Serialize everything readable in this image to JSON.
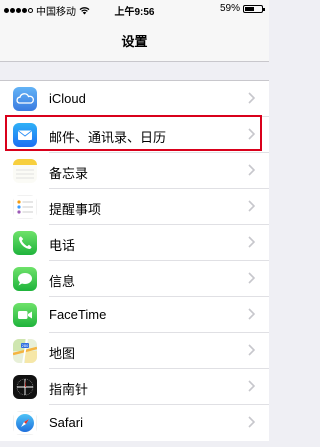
{
  "status_bar": {
    "carrier": "中国移动",
    "time": "上午9:56",
    "battery": "59%",
    "battery_level": 0.59
  },
  "nav": {
    "title": "设置"
  },
  "settings": {
    "items": [
      {
        "label": "iCloud",
        "icon": "icloud-icon"
      },
      {
        "label": "邮件、通讯录、日历",
        "icon": "mail-icon"
      },
      {
        "label": "备忘录",
        "icon": "notes-icon"
      },
      {
        "label": "提醒事项",
        "icon": "reminders-icon"
      },
      {
        "label": "电话",
        "icon": "phone-icon"
      },
      {
        "label": "信息",
        "icon": "messages-icon"
      },
      {
        "label": "FaceTime",
        "icon": "facetime-icon"
      },
      {
        "label": "地图",
        "icon": "maps-icon"
      },
      {
        "label": "指南针",
        "icon": "compass-icon"
      },
      {
        "label": "Safari",
        "icon": "safari-icon"
      }
    ]
  },
  "colors": {
    "highlight": "#d9001b",
    "background": "#efeff4"
  }
}
